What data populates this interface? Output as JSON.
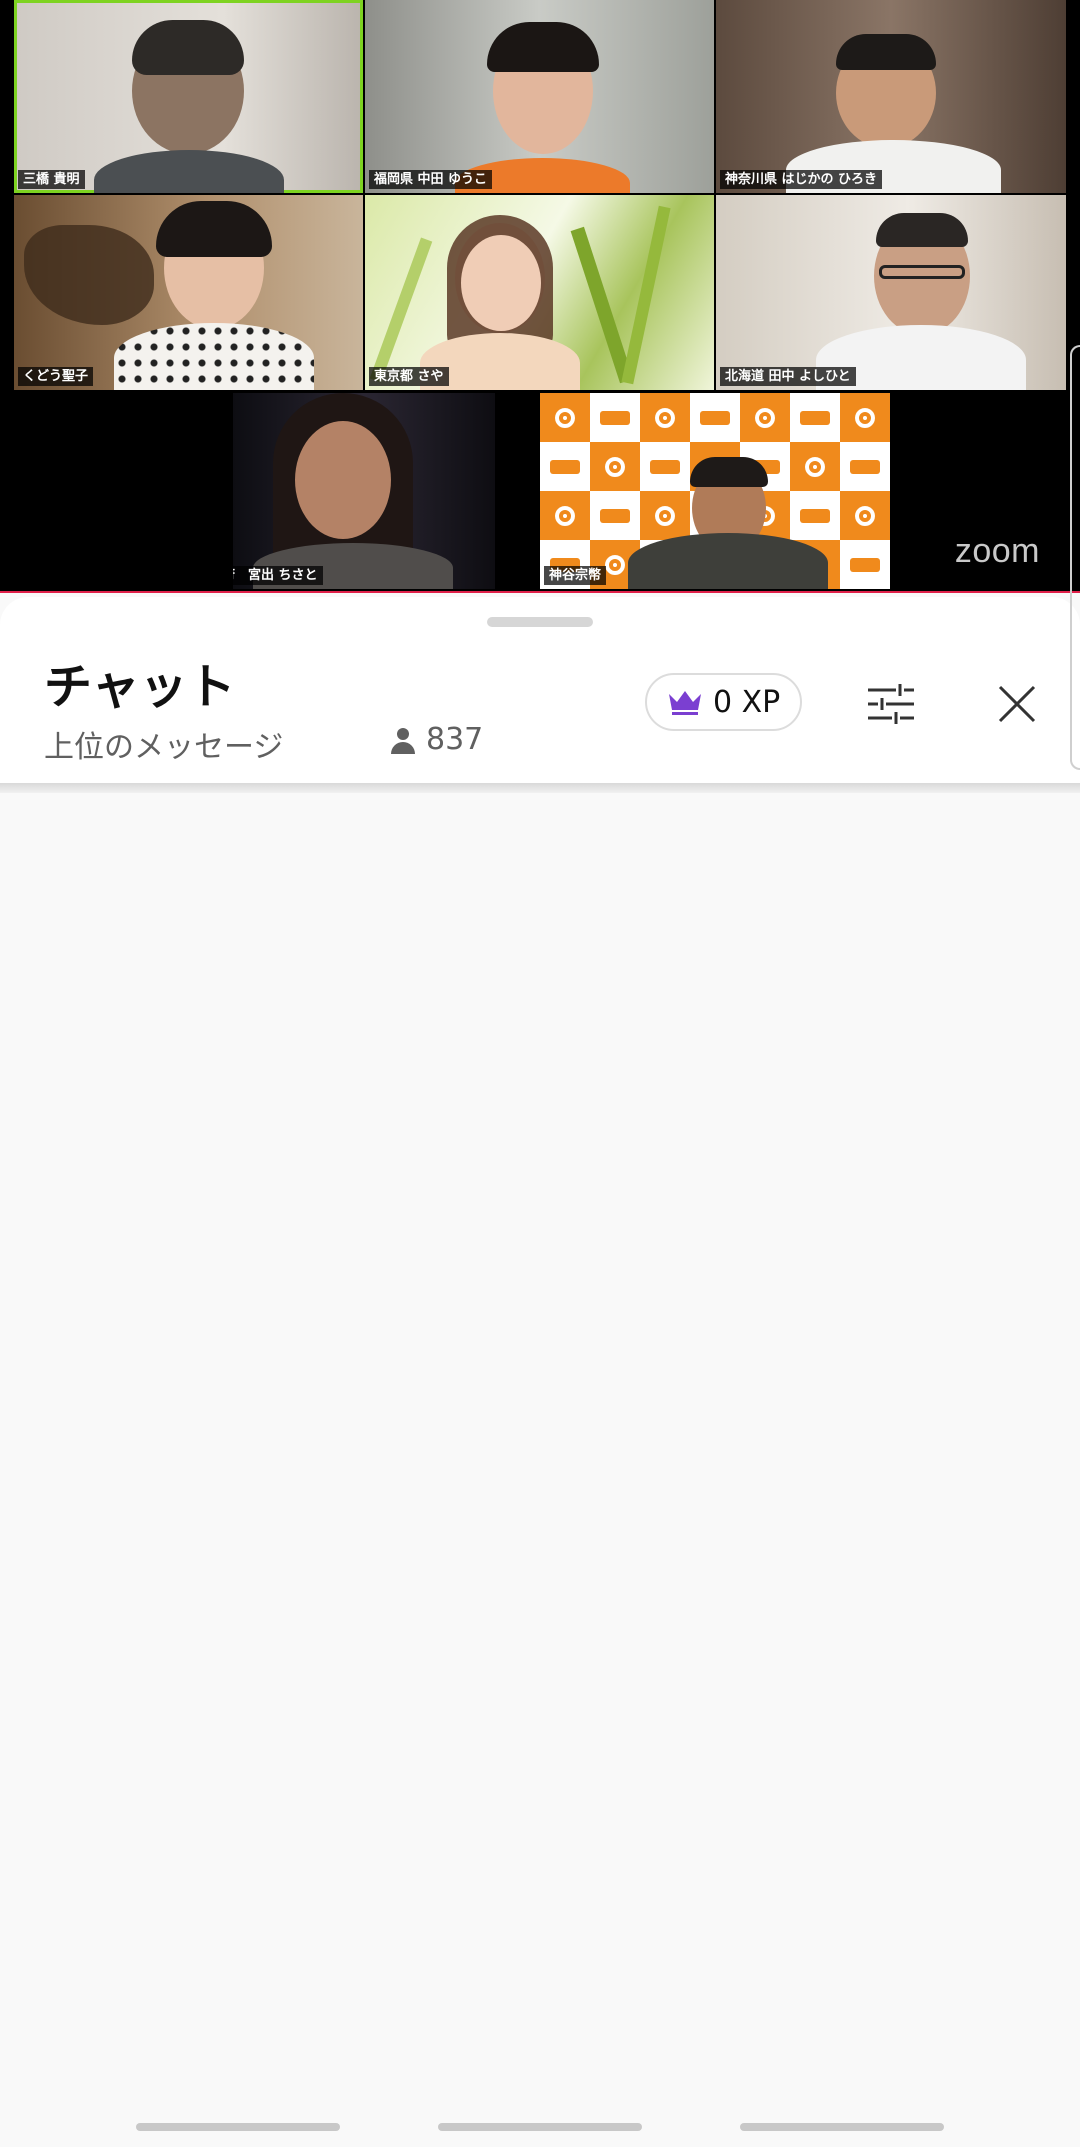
{
  "participants": [
    {
      "name": "三橋 貴明",
      "active": true
    },
    {
      "name": "福岡県 中田 ゆうこ"
    },
    {
      "name": "神奈川県 はじかの ひろき"
    },
    {
      "name": "くどう聖子"
    },
    {
      "name": "東京都 さや"
    },
    {
      "name": "北海道 田中 よしひと"
    },
    {
      "name": "大阪府　宮出 ちさと"
    },
    {
      "name": "神谷宗幣"
    }
  ],
  "zoom_logo": "zoom",
  "chat": {
    "title": "チャット",
    "subtitle": "上位のメッセージ",
    "viewer_count": "837",
    "xp": "0 XP",
    "icons": {
      "viewers": "person-icon",
      "xp": "crown-icon",
      "filter": "sliders-icon",
      "close": "close-icon"
    }
  },
  "colors": {
    "accent_red": "#e0204a",
    "active_speaker": "#7ed321",
    "crown": "#7b3fd1",
    "logo_orange": "#f08a1c"
  }
}
